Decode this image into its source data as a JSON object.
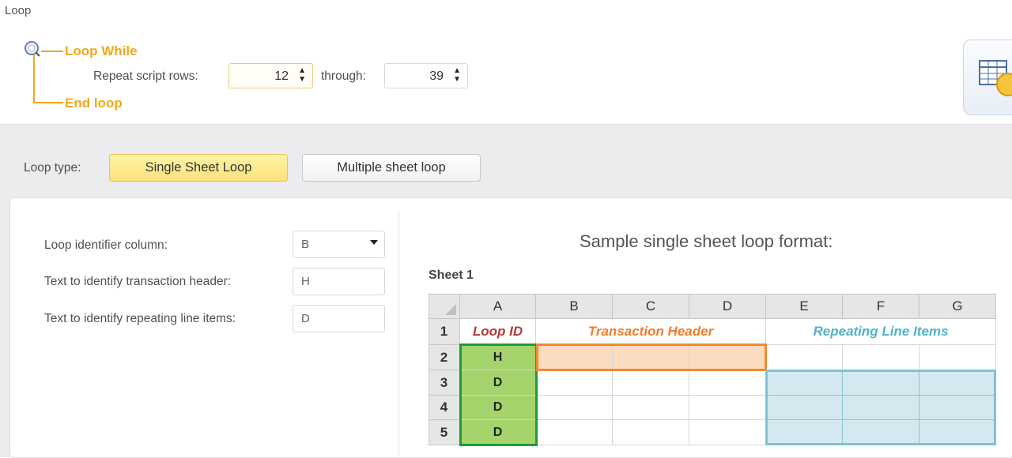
{
  "window": {
    "title": "Loop"
  },
  "loop": {
    "start_label": "Loop While",
    "end_label": "End loop",
    "repeat_label": "Repeat script rows:",
    "from_value": "12",
    "through_label": "through:",
    "to_value": "39"
  },
  "loop_type": {
    "label": "Loop type:",
    "single_label": "Single Sheet Loop",
    "multiple_label": "Multiple sheet loop",
    "selected": "Single Sheet Loop"
  },
  "fields": {
    "identifier_column_label": "Loop identifier column:",
    "identifier_column_value": "B",
    "header_text_label": "Text to identify transaction header:",
    "header_text_value": "H",
    "line_items_label": "Text to identify repeating line items:",
    "line_items_value": "D"
  },
  "sample": {
    "title": "Sample single sheet loop format:",
    "sheet_name": "Sheet 1",
    "columns": [
      "A",
      "B",
      "C",
      "D",
      "E",
      "F",
      "G"
    ],
    "rows": [
      "1",
      "2",
      "3",
      "4",
      "5"
    ],
    "loop_id_label": "Loop ID",
    "transaction_header_label": "Transaction Header",
    "repeating_items_label": "Repeating Line Items",
    "column_a_values": [
      "H",
      "D",
      "D",
      "D"
    ]
  },
  "colors": {
    "accent_orange": "#f0a81c",
    "loop_id": "#b33a3a",
    "transaction_header": "#f07d2a",
    "repeating_items": "#4fb3c9",
    "green_fill": "#a6d46c",
    "green_border": "#1e9a3a",
    "peach_fill": "#fcdcc0",
    "teal_fill": "#d5e8ef"
  }
}
